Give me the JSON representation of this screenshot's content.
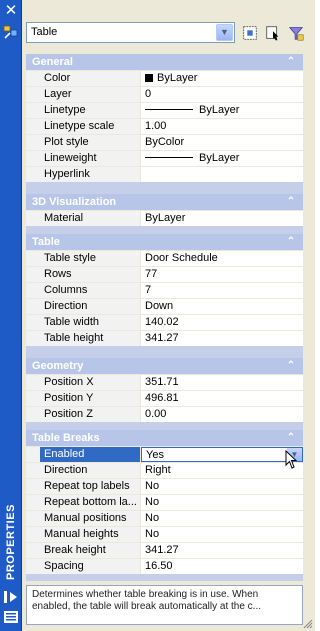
{
  "window": {
    "title": "PROPERTIES",
    "close_glyph": "✕"
  },
  "toolbar": {
    "object_type": "Table",
    "buttons": [
      {
        "icon": "quick-select-icon"
      },
      {
        "icon": "select-objects-icon"
      },
      {
        "icon": "toggle-pickadd-icon"
      }
    ]
  },
  "sections": {
    "general": {
      "title": "General",
      "rows": [
        {
          "label": "Color",
          "value": "ByLayer"
        },
        {
          "label": "Layer",
          "value": "0"
        },
        {
          "label": "Linetype",
          "value": "ByLayer"
        },
        {
          "label": "Linetype scale",
          "value": "1.00"
        },
        {
          "label": "Plot style",
          "value": "ByColor"
        },
        {
          "label": "Lineweight",
          "value": "ByLayer"
        },
        {
          "label": "Hyperlink",
          "value": ""
        }
      ]
    },
    "visualization": {
      "title": "3D Visualization",
      "rows": [
        {
          "label": "Material",
          "value": "ByLayer"
        }
      ]
    },
    "table": {
      "title": "Table",
      "rows": [
        {
          "label": "Table style",
          "value": "Door Schedule"
        },
        {
          "label": "Rows",
          "value": "77"
        },
        {
          "label": "Columns",
          "value": "7"
        },
        {
          "label": "Direction",
          "value": "Down"
        },
        {
          "label": "Table width",
          "value": "140.02"
        },
        {
          "label": "Table height",
          "value": "341.27"
        }
      ]
    },
    "geometry": {
      "title": "Geometry",
      "rows": [
        {
          "label": "Position X",
          "value": "351.71"
        },
        {
          "label": "Position Y",
          "value": "496.81"
        },
        {
          "label": "Position Z",
          "value": "0.00"
        }
      ]
    },
    "breaks": {
      "title": "Table Breaks",
      "rows": [
        {
          "label": "Enabled",
          "value": "Yes"
        },
        {
          "label": "Direction",
          "value": "Right"
        },
        {
          "label": "Repeat top labels",
          "value": "No"
        },
        {
          "label": "Repeat bottom la...",
          "value": "No"
        },
        {
          "label": "Manual positions",
          "value": "No"
        },
        {
          "label": "Manual heights",
          "value": "No"
        },
        {
          "label": "Break height",
          "value": "341.27"
        },
        {
          "label": "Spacing",
          "value": "16.50"
        }
      ]
    }
  },
  "description": "Determines whether table breaking is in use. When enabled, the table will break automatically at the c...",
  "colors": {
    "title_strip": "#1e5bc6",
    "section_header": "#b7c5e8",
    "selected_label": "#316ac5"
  }
}
